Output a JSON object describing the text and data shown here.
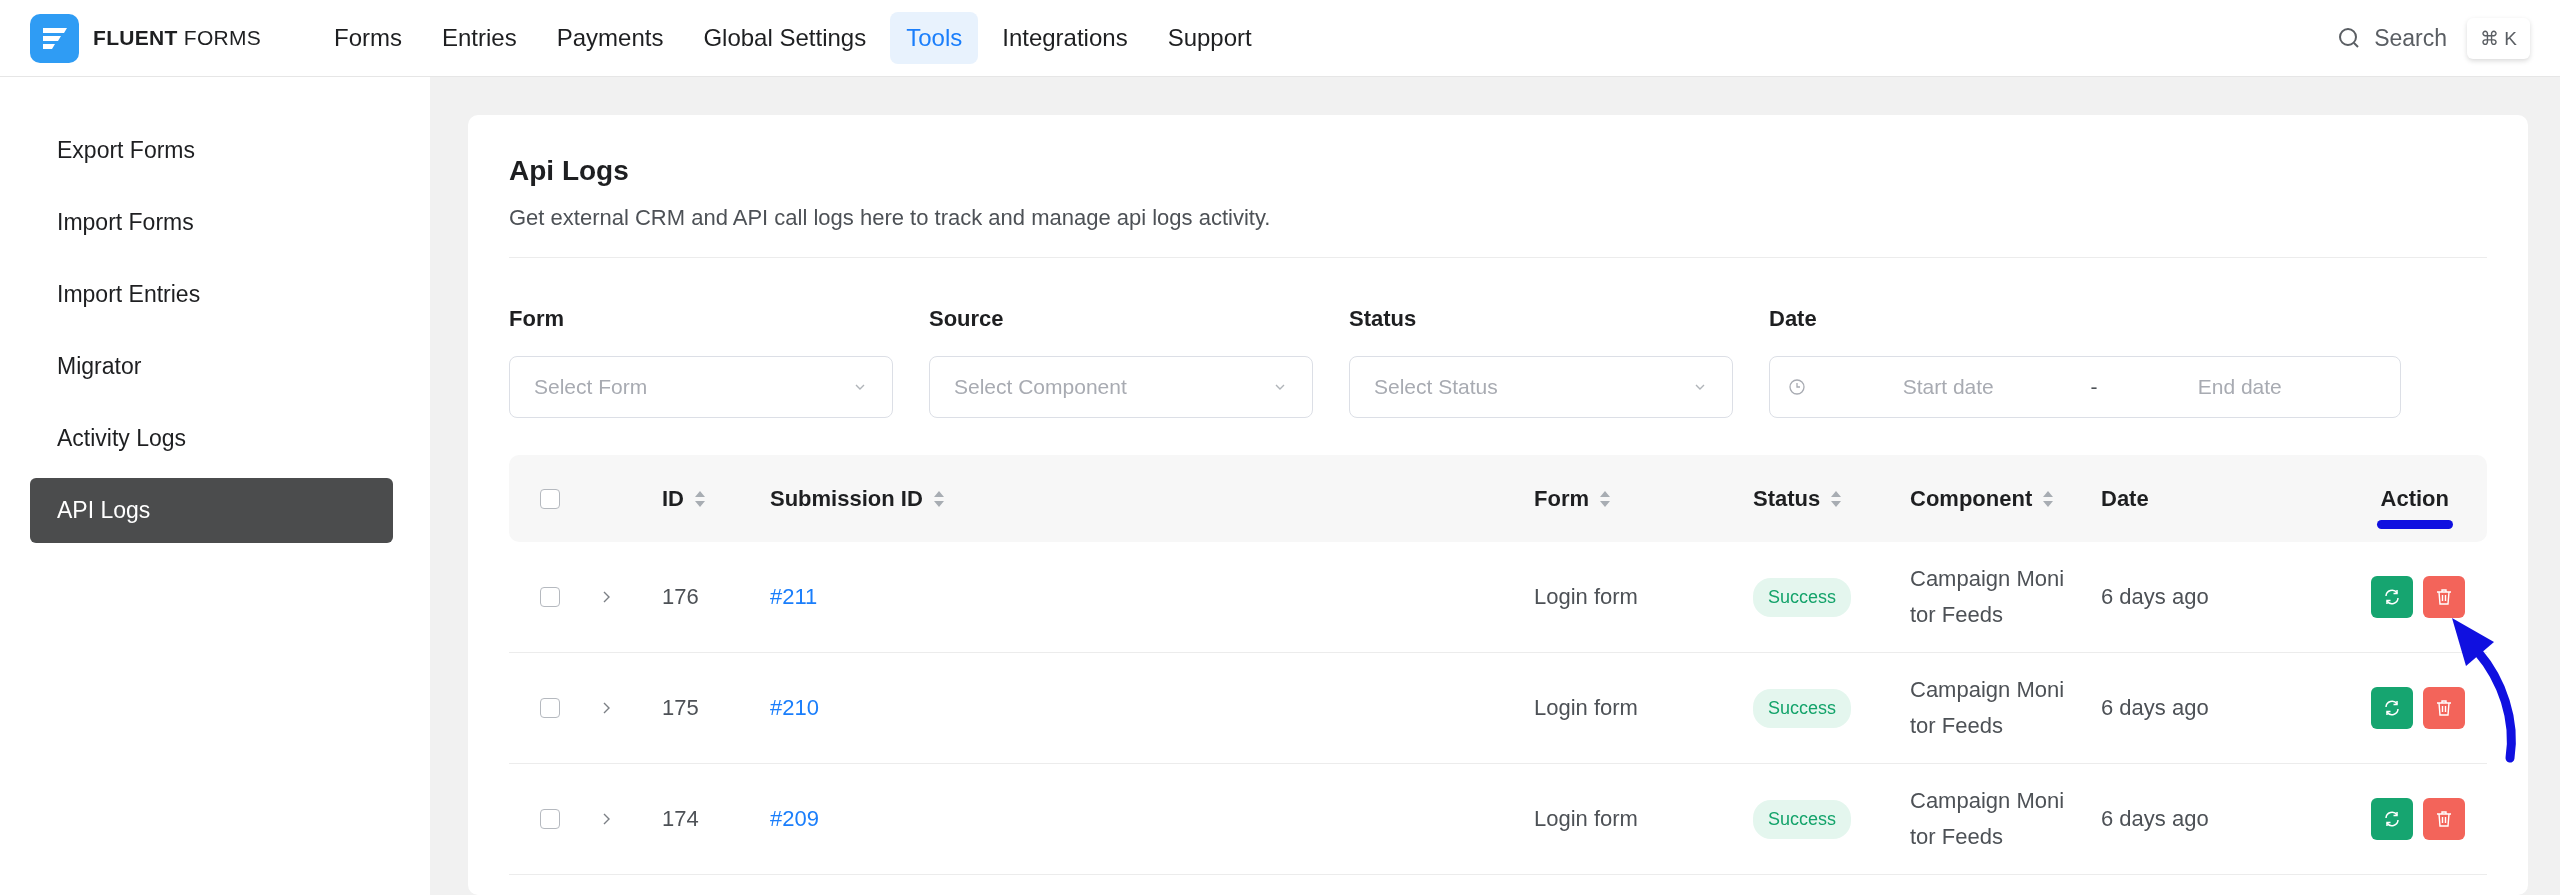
{
  "brand": {
    "name": "**FLUENT** FORMS"
  },
  "nav": [
    {
      "label": "Forms",
      "selected": false
    },
    {
      "label": "Entries",
      "selected": false
    },
    {
      "label": "Payments",
      "selected": false
    },
    {
      "label": "Global Settings",
      "selected": false
    },
    {
      "label": "Tools",
      "selected": true
    },
    {
      "label": "Integrations",
      "selected": false
    },
    {
      "label": "Support",
      "selected": false
    }
  ],
  "search": {
    "label": "Search",
    "shortcut": "⌘ K"
  },
  "sidebar": {
    "items": [
      {
        "label": "Export Forms",
        "selected": false
      },
      {
        "label": "Import Forms",
        "selected": false
      },
      {
        "label": "Import Entries",
        "selected": false
      },
      {
        "label": "Migrator",
        "selected": false
      },
      {
        "label": "Activity Logs",
        "selected": false
      },
      {
        "label": "API Logs",
        "selected": true
      }
    ]
  },
  "panel": {
    "title": "Api Logs",
    "description": "Get external CRM and API call logs here to track and manage api logs activity."
  },
  "filters": [
    {
      "kind": "select",
      "label": "Form",
      "placeholder": "Select Form"
    },
    {
      "kind": "select",
      "label": "Source",
      "placeholder": "Select Component"
    },
    {
      "kind": "select",
      "label": "Status",
      "placeholder": "Select Status"
    },
    {
      "kind": "daterange",
      "label": "Date",
      "start_placeholder": "Start date",
      "separator": "-",
      "end_placeholder": "End date"
    }
  ],
  "table": {
    "select_all": {
      "checked": false
    },
    "columns": [
      {
        "label": "ID",
        "sortable": true
      },
      {
        "label": "Submission ID",
        "sortable": true
      },
      {
        "label": "Form",
        "sortable": true
      },
      {
        "label": "Status",
        "sortable": true
      },
      {
        "label": "Component",
        "sortable": true
      },
      {
        "label": "Date",
        "sortable": false
      },
      {
        "label": "Action",
        "sortable": false
      }
    ],
    "rows": [
      {
        "checked": false,
        "expanded": false,
        "id": "176",
        "submission_id": "#211",
        "form": "Login form",
        "status": "Success",
        "component": "Campaign Monitor Feeds",
        "date": "6 days ago"
      },
      {
        "checked": false,
        "expanded": false,
        "id": "175",
        "submission_id": "#210",
        "form": "Login form",
        "status": "Success",
        "component": "Campaign Monitor Feeds",
        "date": "6 days ago"
      },
      {
        "checked": false,
        "expanded": false,
        "id": "174",
        "submission_id": "#209",
        "form": "Login form",
        "status": "Success",
        "component": "Campaign Monitor Feeds",
        "date": "6 days ago"
      }
    ]
  }
}
